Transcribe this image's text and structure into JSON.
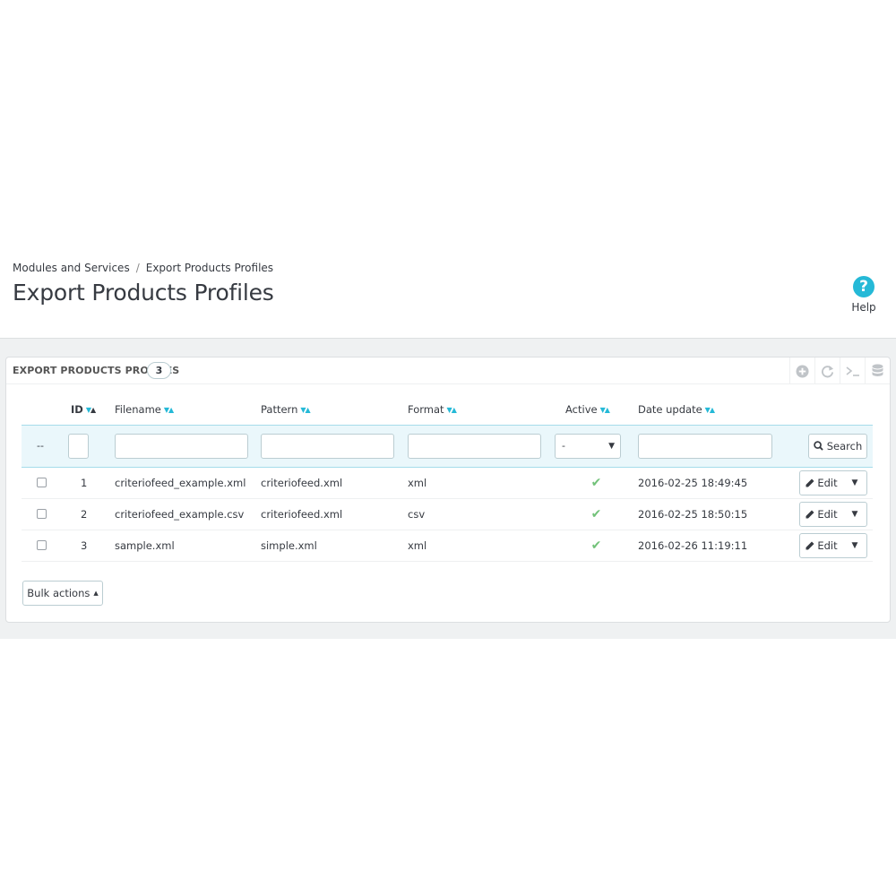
{
  "breadcrumb": {
    "parent": "Modules and Services",
    "separator": "/",
    "current": "Export Products Profiles"
  },
  "page": {
    "title": "Export Products Profiles",
    "help_label": "Help",
    "help_glyph": "?"
  },
  "panel": {
    "title": "EXPORT PRODUCTS PROFILES",
    "count": "3",
    "toolbar": [
      "add-icon",
      "refresh-icon",
      "terminal-icon",
      "database-icon"
    ]
  },
  "table": {
    "columns": {
      "id": "ID",
      "filename": "Filename",
      "pattern": "Pattern",
      "format": "Format",
      "active": "Active",
      "date_update": "Date update"
    },
    "filter": {
      "bulk_placeholder": "--",
      "active_selected": "-",
      "search_label": "Search"
    },
    "rows": [
      {
        "id": "1",
        "filename": "criteriofeed_example.xml",
        "pattern": "criteriofeed.xml",
        "format": "xml",
        "active": "✔",
        "date_update": "2016-02-25 18:49:45",
        "edit_label": "Edit"
      },
      {
        "id": "2",
        "filename": "criteriofeed_example.csv",
        "pattern": "criteriofeed.xml",
        "format": "csv",
        "active": "✔",
        "date_update": "2016-02-25 18:50:15",
        "edit_label": "Edit"
      },
      {
        "id": "3",
        "filename": "sample.xml",
        "pattern": "simple.xml",
        "format": "xml",
        "active": "✔",
        "date_update": "2016-02-26 11:19:11",
        "edit_label": "Edit"
      }
    ]
  },
  "footer": {
    "bulk_actions_label": "Bulk actions"
  },
  "colors": {
    "accent": "#25b9d7",
    "success": "#72c279",
    "text": "#363a41",
    "background": "#eff1f2"
  }
}
